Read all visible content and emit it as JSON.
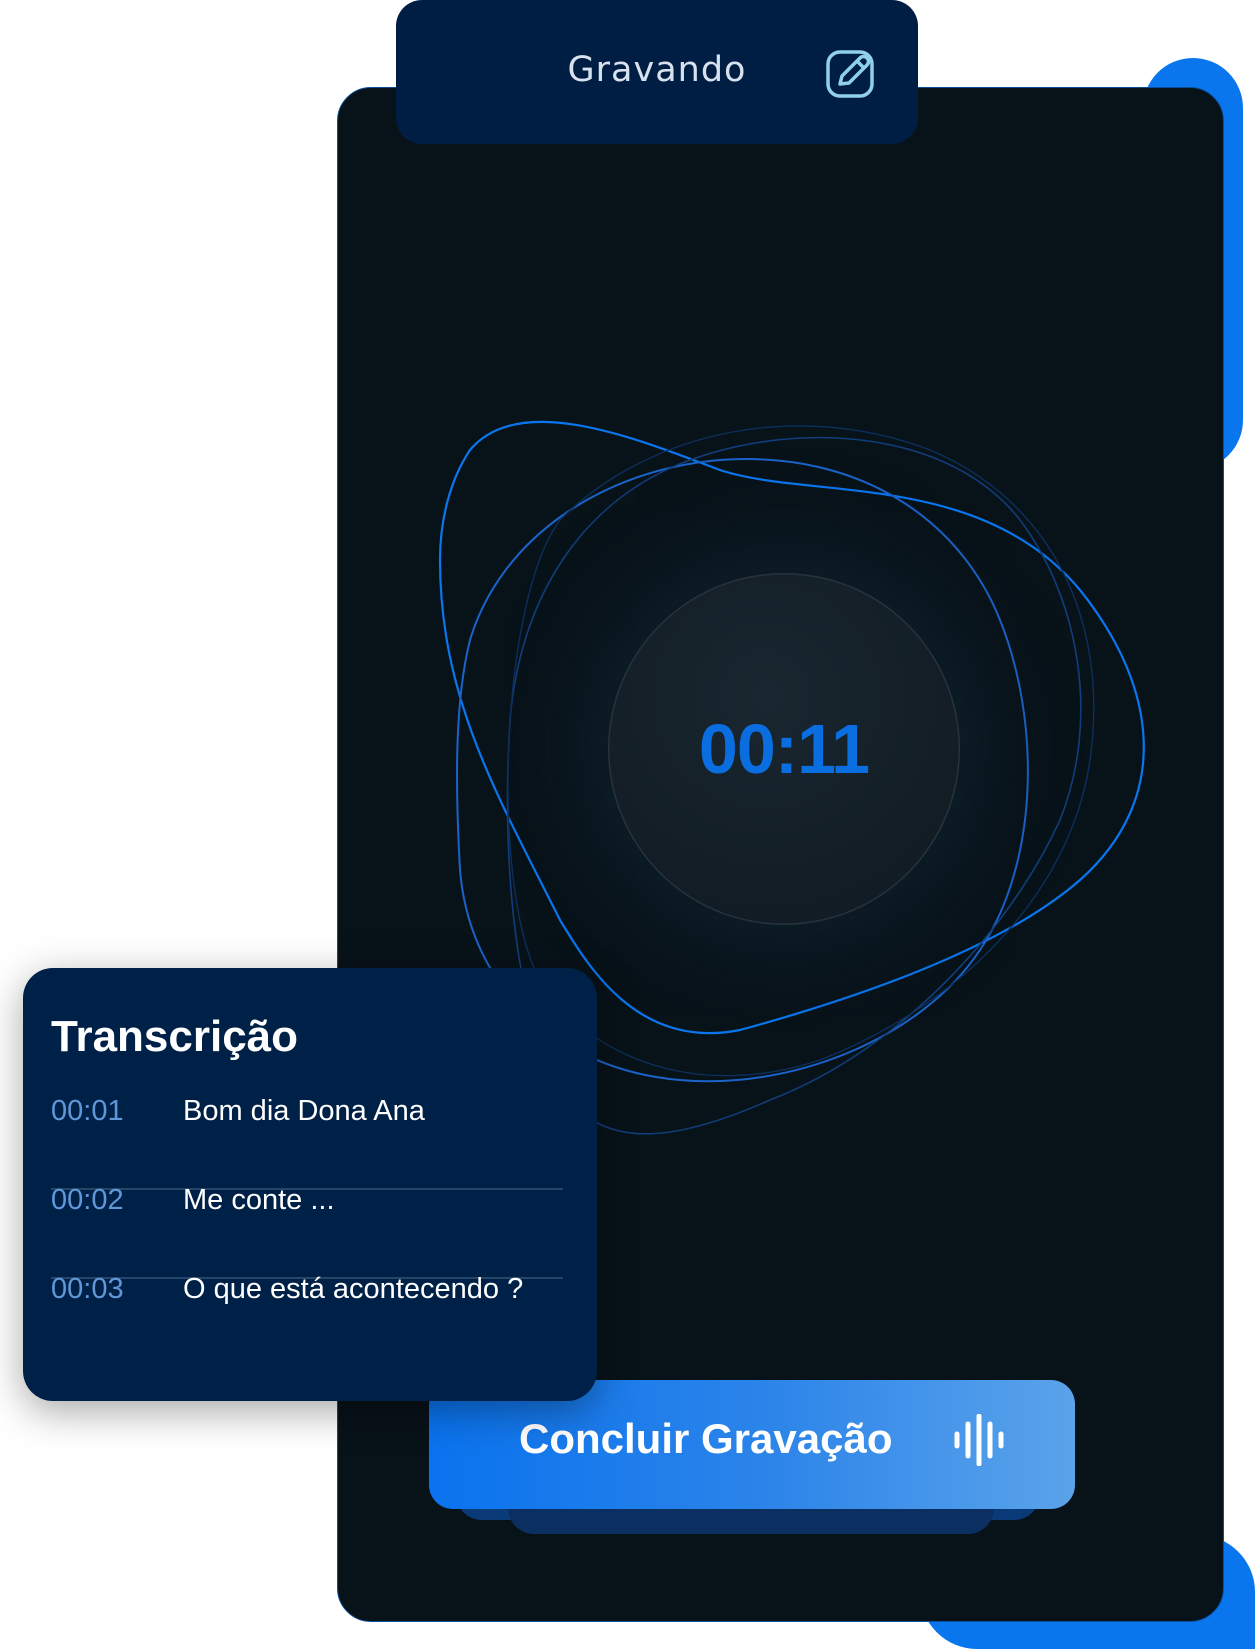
{
  "header": {
    "title": "Gravando",
    "edit_icon": "edit-icon"
  },
  "recorder": {
    "elapsed": "00:11"
  },
  "transcript": {
    "title": "Transcrição",
    "entries": [
      {
        "time": "00:01",
        "text": "Bom dia Dona Ana"
      },
      {
        "time": "00:02",
        "text": "Me conte ..."
      },
      {
        "time": "00:03",
        "text": "O que está acontecendo ?"
      }
    ]
  },
  "actions": {
    "finish_label": "Concluir Gravação",
    "finish_icon": "audio-wave-icon"
  },
  "colors": {
    "accent": "#0a76ee",
    "panel": "#001e44",
    "screen": "#081219",
    "timer": "#0a6ee0"
  }
}
